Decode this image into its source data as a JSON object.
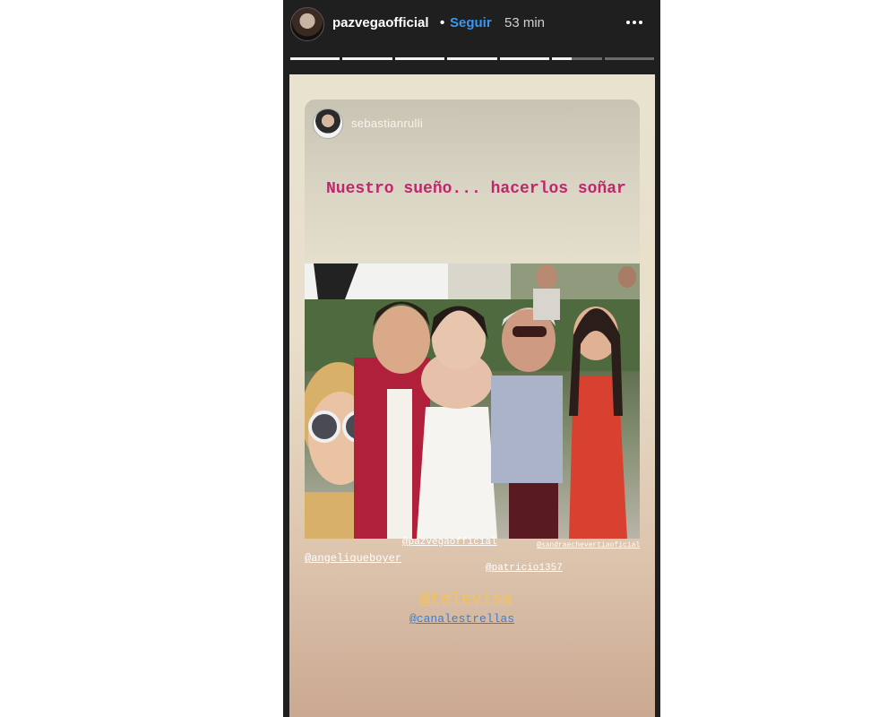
{
  "header": {
    "username": "pazvegaofficial",
    "separator": "•",
    "follow_label": "Seguir",
    "time": "53 min"
  },
  "progress": {
    "segments_total": 7,
    "segments_done": 5,
    "current_fraction": 0.4
  },
  "story": {
    "shared_post": {
      "username": "sebastianrulli",
      "quote": "Nuestro sueño... hacerlos soñar"
    },
    "mentions": [
      "@pazvegaofficial",
      "@sandraechevertiaoficial",
      "@angeliqueboyer",
      "@patricio1357",
      "@televisa",
      "@canalestrellas"
    ]
  },
  "colors": {
    "follow": "#3897f0",
    "quote": "#c0266d",
    "televisa": "#f3c35b",
    "canalestrellas": "#3f7fc9"
  }
}
